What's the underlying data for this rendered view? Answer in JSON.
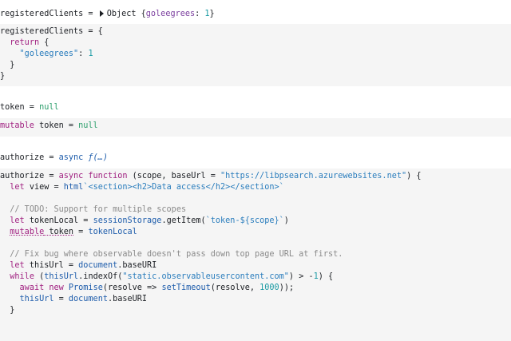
{
  "cells": {
    "c1_output": {
      "name": "registeredClients",
      "eq": " = ",
      "type_label": "Object",
      "open": " {",
      "key": "goleegrees",
      "colon": ": ",
      "value": "1",
      "close": "}"
    },
    "c1_code": {
      "l1": "registeredClients = {",
      "l2_kw": "return",
      "l2_rest": " {",
      "l3_str": "\"goleegrees\"",
      "l3_colon": ": ",
      "l3_num": "1",
      "l4": "}",
      "l5": "}"
    },
    "c2_output": {
      "name": "token",
      "eq": " = ",
      "value": "null"
    },
    "c2_code": {
      "kw": "mutable",
      "rest": " token = ",
      "value": "null"
    },
    "c3_output": {
      "name": "authorize",
      "eq": " = ",
      "async": "async",
      "fn": " ƒ(…)"
    },
    "c3_code": {
      "l1_a": "authorize = ",
      "l1_kw1": "async",
      "l1_kw2": " function",
      "l1_b": " (scope, baseUrl = ",
      "l1_str": "\"https://libpsearch.azurewebsites.net\"",
      "l1_c": ") {",
      "l2_kw": "let",
      "l2_a": " view = ",
      "l2_fn": "html",
      "l2_str": "`<section><h2>Data access</h2></section>`",
      "l4_comment": "// TODO: Support for multiple scopes",
      "l5_kw": "let",
      "l5_a": " tokenLocal = ",
      "l5_fn": "sessionStorage",
      "l5_b": ".getItem(",
      "l5_str": "`token-${scope}`",
      "l5_c": ")",
      "l6_kw": "mutable",
      "l6_a": " token",
      "l6_b": " = ",
      "l6_fn": "tokenLocal",
      "l8_comment": "// Fix bug where observable doesn't pass down top page URL at first.",
      "l9_kw": "let",
      "l9_a": " thisUrl = ",
      "l9_fn": "document",
      "l9_b": ".baseURI",
      "l10_kw": "while",
      "l10_a": " (",
      "l10_fn": "thisUrl",
      "l10_b": ".indexOf(",
      "l10_str": "\"static.observableusercontent.com\"",
      "l10_c": ") > -",
      "l10_num": "1",
      "l10_d": ") {",
      "l11_kw1": "await",
      "l11_kw2": " new",
      "l11_fn1": " Promise",
      "l11_a": "(resolve => ",
      "l11_fn2": "setTimeout",
      "l11_b": "(resolve, ",
      "l11_num": "1000",
      "l11_c": "));",
      "l12_fn1": "thisUrl",
      "l12_a": " = ",
      "l12_fn2": "document",
      "l12_b": ".baseURI",
      "l13": "}"
    }
  }
}
